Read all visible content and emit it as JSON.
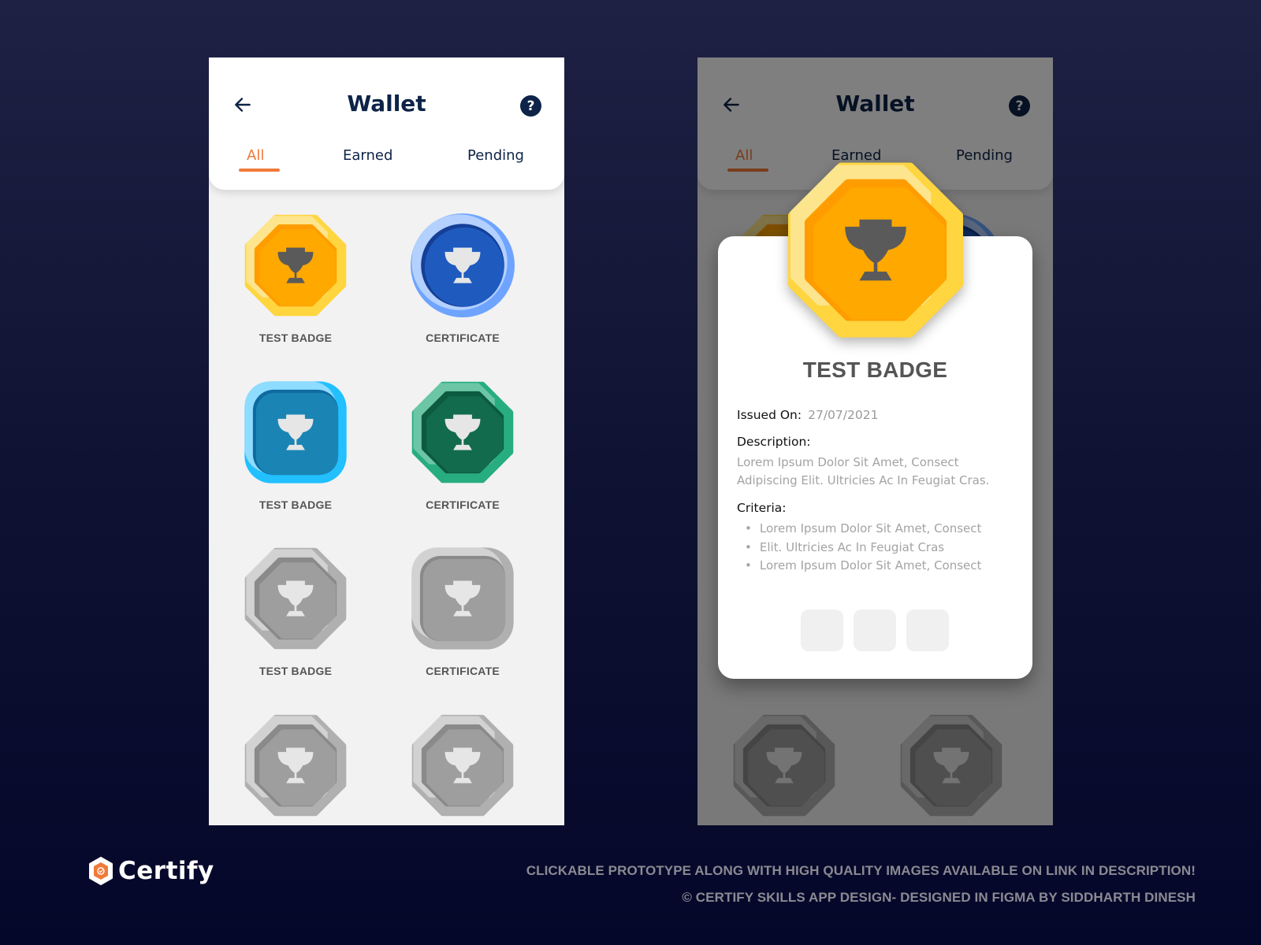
{
  "screens": {
    "left": {
      "header": {
        "title": "Wallet",
        "back_icon": "arrow-left-icon",
        "help_icon": "question-circle-icon",
        "help_glyph": "?"
      },
      "tabs": [
        {
          "label": "All",
          "active": true
        },
        {
          "label": "Earned",
          "active": false
        },
        {
          "label": "Pending",
          "active": false
        }
      ],
      "items": [
        {
          "label": "TEST BADGE",
          "shape": "octagon",
          "theme": "gold",
          "icon": "trophy-icon"
        },
        {
          "label": "CERTIFICATE",
          "shape": "circle",
          "theme": "blue",
          "icon": "trophy-icon"
        },
        {
          "label": "TEST BADGE",
          "shape": "rounded-square",
          "theme": "sky",
          "icon": "trophy-icon"
        },
        {
          "label": "CERTIFICATE",
          "shape": "octagon",
          "theme": "green",
          "icon": "trophy-icon"
        },
        {
          "label": "TEST BADGE",
          "shape": "octagon",
          "theme": "gray",
          "icon": "trophy-icon"
        },
        {
          "label": "CERTIFICATE",
          "shape": "rounded-square",
          "theme": "gray",
          "icon": "trophy-icon"
        },
        {
          "label": "",
          "shape": "octagon",
          "theme": "gray",
          "icon": "trophy-icon"
        },
        {
          "label": "",
          "shape": "octagon",
          "theme": "gray",
          "icon": "trophy-icon"
        }
      ]
    },
    "right": {
      "header": {
        "title": "Wallet",
        "back_icon": "arrow-left-icon",
        "help_icon": "question-circle-icon",
        "help_glyph": "?"
      },
      "tabs": [
        {
          "label": "All",
          "active": true
        },
        {
          "label": "Earned",
          "active": false
        },
        {
          "label": "Pending",
          "active": false
        }
      ],
      "detail": {
        "title": "TEST BADGE",
        "issued_label": "Issued On:",
        "issued_value": "27/07/2021",
        "description_label": "Description:",
        "description_text": "Lorem Ipsum Dolor Sit Amet, Consect Adipiscing Elit. Ultricies Ac In Feugiat Cras.",
        "criteria_label": "Criteria:",
        "criteria": [
          "Lorem Ipsum Dolor Sit Amet, Consect",
          "Elit. Ultricies Ac In Feugiat Cras",
          "Lorem Ipsum Dolor Sit Amet, Consect"
        ],
        "actions": [
          "action-1",
          "action-2",
          "action-3"
        ]
      }
    }
  },
  "brand": {
    "name": "Certify",
    "accent": "#f07a3a"
  },
  "footer": {
    "line1": "CLICKABLE PROTOTYPE ALONG WITH HIGH QUALITY IMAGES AVAILABLE ON LINK IN DESCRIPTION!",
    "line2": "© CERTIFY SKILLS APP DESIGN- DESIGNED IN FIGMA BY SIDDHARTH DINESH"
  },
  "colors": {
    "title": "#0d2347",
    "tab_active": "#f07a3a",
    "gold": [
      "#fde58e",
      "#ffd540",
      "#ff9d00",
      "#ffa800"
    ],
    "blue": [
      "#b3d0ff",
      "#6ea4ff",
      "#153f97",
      "#1f5bbf"
    ],
    "sky": [
      "#8edcff",
      "#22c0ff",
      "#0e6aa0",
      "#1a85b5"
    ],
    "green": [
      "#6cc6a6",
      "#27ad80",
      "#0c5a40",
      "#126b4d"
    ],
    "gray": [
      "#d2d2d2",
      "#b0b0b0",
      "#8a8a8a",
      "#9e9e9e"
    ]
  }
}
